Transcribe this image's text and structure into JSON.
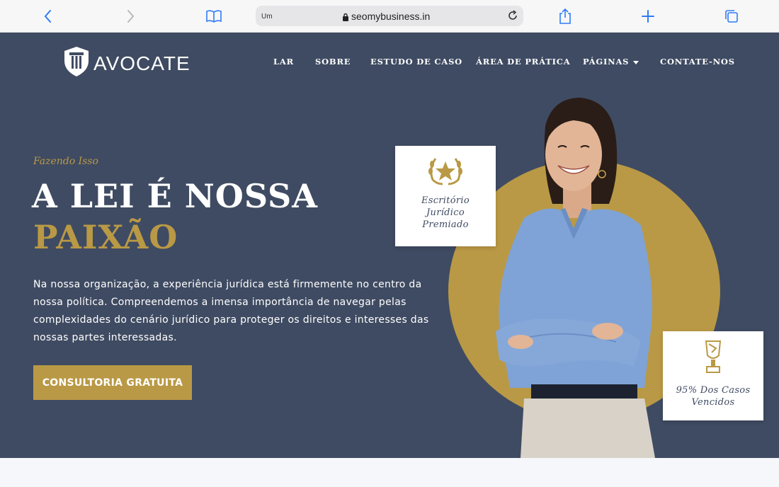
{
  "browser": {
    "url_prefix": "Um",
    "url": "seomybusiness.in",
    "back_icon": "chevron-left-icon",
    "forward_icon": "chevron-right-icon",
    "reader_icon": "book-icon",
    "share_icon": "share-icon",
    "new_tab_icon": "plus-icon",
    "tabs_icon": "tabs-icon"
  },
  "brand": {
    "logo_text": "AVOCATE"
  },
  "nav": [
    {
      "label": "LAR"
    },
    {
      "label": "SOBRE"
    },
    {
      "label": "ESTUDO DE CASO"
    },
    {
      "label": "ÁREA DE PRÁTICA"
    },
    {
      "label": "PÁGINAS"
    },
    {
      "label": "CONTATE-NOS"
    }
  ],
  "hero": {
    "eyebrow": "Fazendo Isso",
    "title_line1": "A LEI É NOSSA",
    "title_line2": "PAIXÃO",
    "description": "Na nossa organização, a experiência jurídica está firmemente no centro da nossa política. Compreendemos a imensa importância de navegar pelas complexidades do cenário jurídico para proteger os direitos e interesses das nossas partes interessadas.",
    "cta_label": "CONSULTORIA GRATUITA"
  },
  "cards": {
    "award": {
      "text": "Escritório Jurídico Premiado",
      "icon": "laurel-star-icon"
    },
    "cases": {
      "text": "95% Dos Casos Vencidos",
      "icon": "trophy-icon"
    }
  },
  "colors": {
    "navy": "#3f4b62",
    "gold": "#b99945",
    "white": "#ffffff"
  }
}
